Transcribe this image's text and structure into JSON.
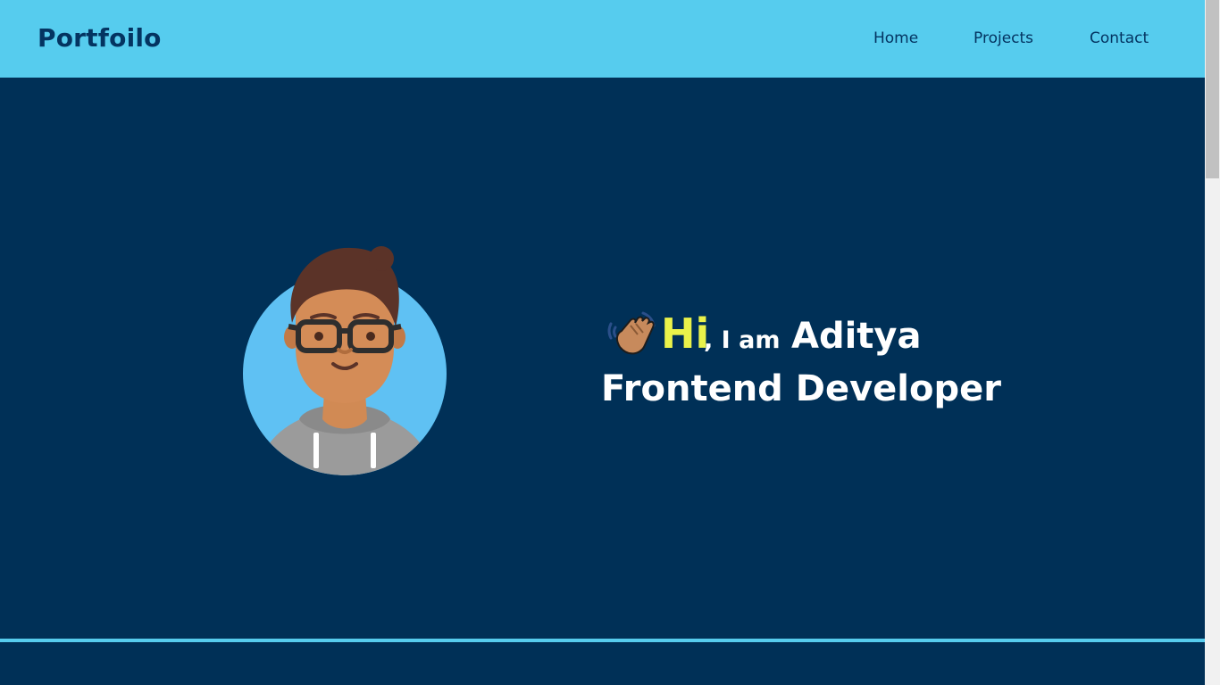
{
  "navbar": {
    "brand": "Portfoilo",
    "links": [
      {
        "label": "Home"
      },
      {
        "label": "Projects"
      },
      {
        "label": "Contact"
      }
    ]
  },
  "hero": {
    "wave_icon": "waving-hand-icon",
    "hi": "Hi",
    "intro": ", I am",
    "name": "Aditya",
    "role": "Frontend Developer",
    "avatar": "developer-avatar"
  },
  "colors": {
    "navbar_bg": "#56ccee",
    "page_bg": "#003057",
    "brand_text": "#043461",
    "hi_accent": "#eaf24a",
    "hero_text": "#ffffff"
  }
}
